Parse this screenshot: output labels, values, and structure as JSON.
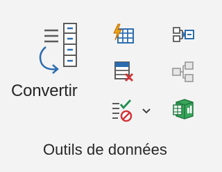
{
  "ribbon_group": {
    "label": "Outils de données",
    "convert_button": {
      "label": "Convertir",
      "icon": "text-to-columns-icon"
    },
    "small_buttons": [
      {
        "name": "flash-fill-button",
        "icon": "flash-fill-icon"
      },
      {
        "name": "remove-duplicates-button",
        "icon": "remove-duplicates-icon"
      },
      {
        "name": "data-validation-button",
        "icon": "data-validation-icon"
      },
      {
        "name": "consolidate-button",
        "icon": "consolidate-icon"
      },
      {
        "name": "relationships-button",
        "icon": "relationships-icon"
      },
      {
        "name": "manage-data-model-button",
        "icon": "manage-data-model-icon"
      }
    ],
    "colors": {
      "background": "#f3f3f3",
      "text": "#262626",
      "icon_blue": "#2b6cb0",
      "icon_red": "#d13438",
      "icon_green": "#1f8f4e",
      "icon_orange": "#e8a317",
      "icon_gray": "#8a8a8a"
    }
  }
}
